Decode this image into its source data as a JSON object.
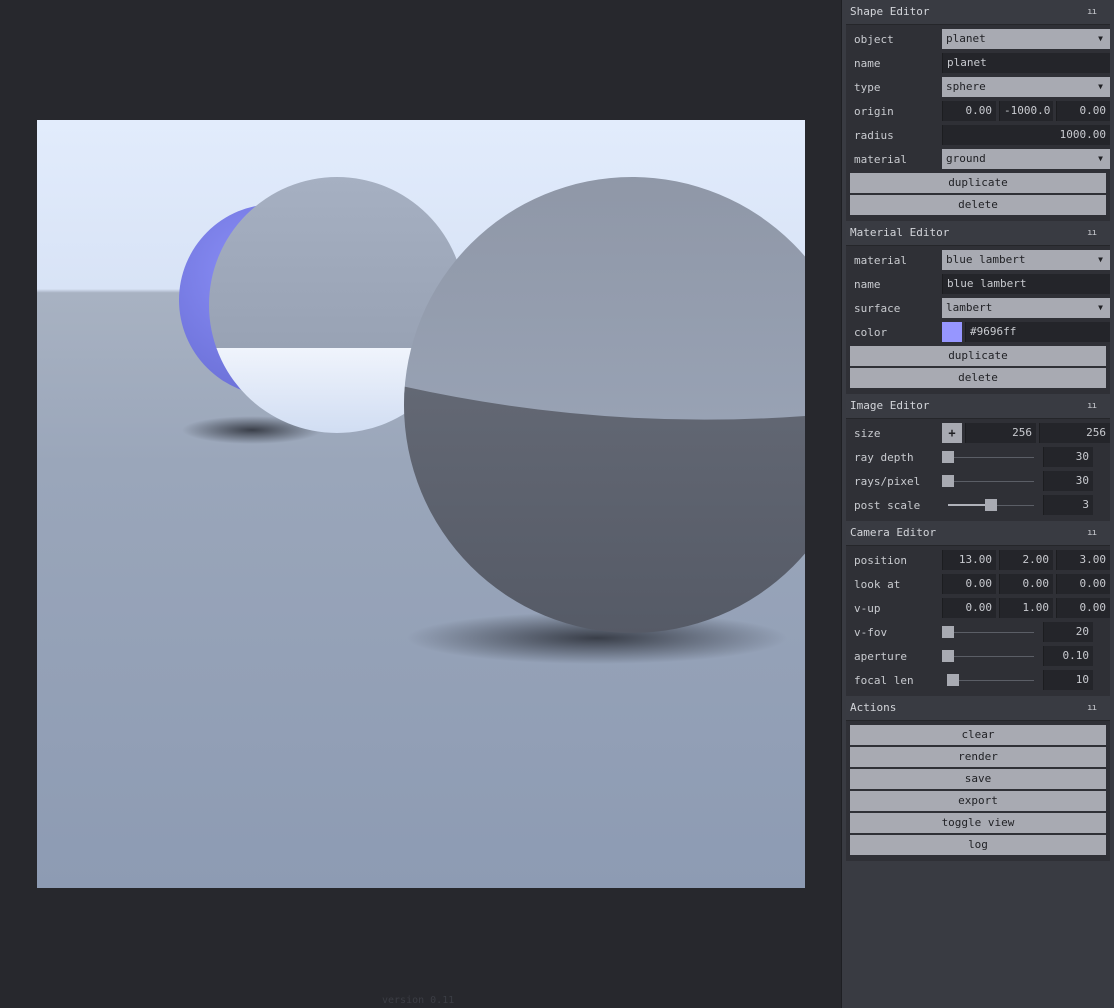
{
  "version": "version 0.11",
  "shape_editor": {
    "title": "Shape Editor",
    "grip": "ıı",
    "object_label": "object",
    "object_value": "planet",
    "name_label": "name",
    "name_value": "planet",
    "type_label": "type",
    "type_value": "sphere",
    "origin_label": "origin",
    "origin_x": "0.00",
    "origin_y": "-1000.0",
    "origin_z": "0.00",
    "radius_label": "radius",
    "radius_value": "1000.00",
    "material_label": "material",
    "material_value": "ground",
    "duplicate": "duplicate",
    "delete": "delete"
  },
  "material_editor": {
    "title": "Material Editor",
    "grip": "ıı",
    "material_label": "material",
    "material_value": "blue lambert",
    "name_label": "name",
    "name_value": "blue lambert",
    "surface_label": "surface",
    "surface_value": "lambert",
    "color_label": "color",
    "color_value": "#9696ff",
    "duplicate": "duplicate",
    "delete": "delete"
  },
  "image_editor": {
    "title": "Image Editor",
    "grip": "ıı",
    "size_label": "size",
    "size_plus": "+",
    "size_w": "256",
    "size_h": "256",
    "ray_depth_label": "ray depth",
    "ray_depth_value": "30",
    "ray_depth_level": 0.0,
    "rays_pixel_label": "rays/pixel",
    "rays_pixel_value": "30",
    "rays_pixel_level": 0.0,
    "post_scale_label": "post scale",
    "post_scale_value": "3",
    "post_scale_level": 0.5
  },
  "camera_editor": {
    "title": "Camera Editor",
    "grip": "ıı",
    "position_label": "position",
    "position_x": "13.00",
    "position_y": "2.00",
    "position_z": "3.00",
    "look_at_label": "look at",
    "look_at_x": "0.00",
    "look_at_y": "0.00",
    "look_at_z": "0.00",
    "v_up_label": "v-up",
    "v_up_x": "0.00",
    "v_up_y": "1.00",
    "v_up_z": "0.00",
    "v_fov_label": "v-fov",
    "v_fov_value": "20",
    "v_fov_level": 0.0,
    "aperture_label": "aperture",
    "aperture_value": "0.10",
    "aperture_level": 0.0,
    "focal_len_label": "focal len",
    "focal_len_value": "10",
    "focal_len_level": 0.06
  },
  "actions": {
    "title": "Actions",
    "grip": "ıı",
    "buttons": [
      "clear",
      "render",
      "save",
      "export",
      "toggle view",
      "log"
    ]
  },
  "colors": {
    "background": "#27282d",
    "panel": "#393b42",
    "field": "#24252a",
    "button": "#a8aab2",
    "swatch": "#9696ff"
  }
}
